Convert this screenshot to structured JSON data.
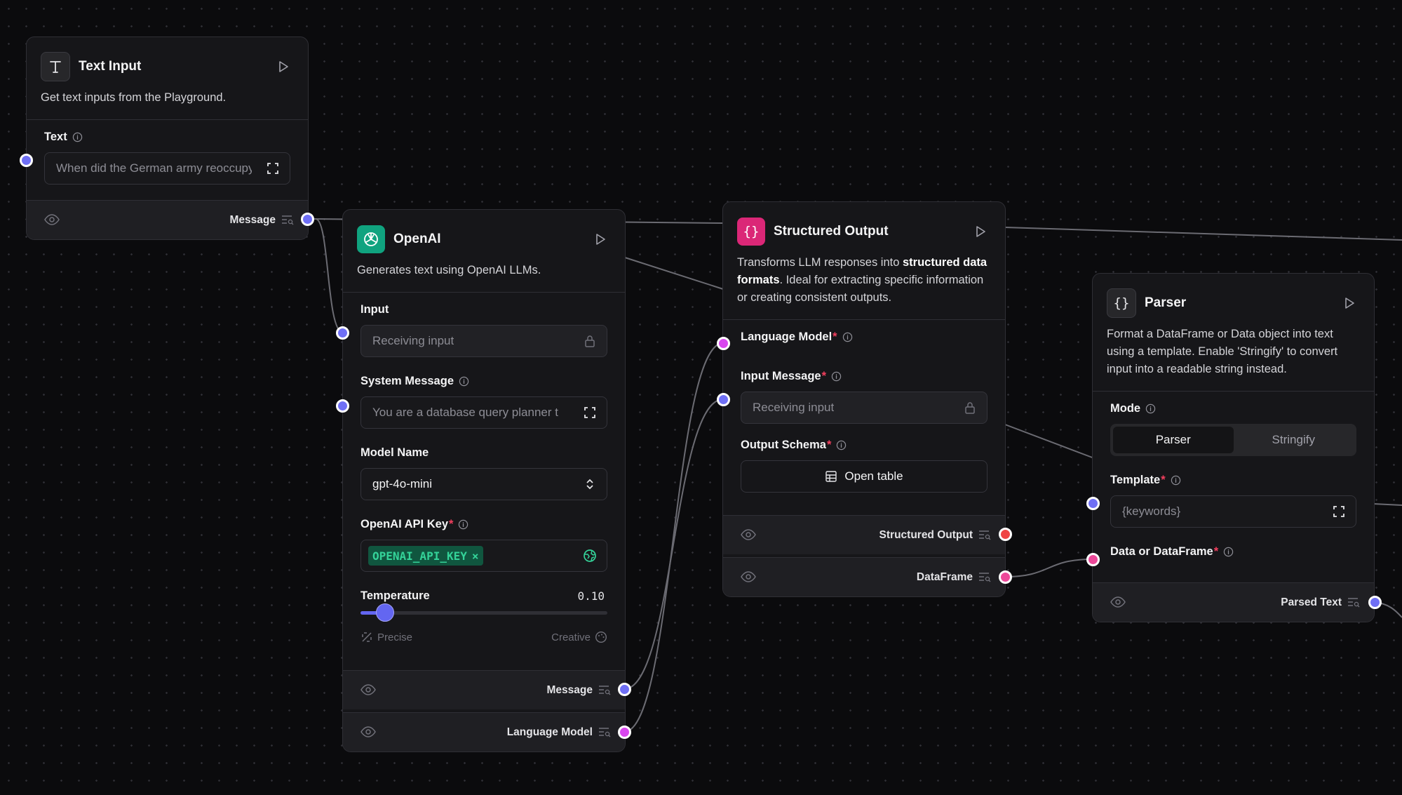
{
  "colors": {
    "canvas": "#0b0b0d",
    "node_bg": "#161619",
    "handle_blue": "#6f6ff5",
    "handle_magenta": "#d946ef",
    "handle_pink": "#ec4899",
    "handle_red": "#ef4444",
    "badge_green": "#34d399"
  },
  "text_input_node": {
    "title": "Text Input",
    "icon": "text-type-icon",
    "description": "Get text inputs from the Playground.",
    "text_label": "Text",
    "text_value": "When did the German army reoccupy",
    "output_label": "Message"
  },
  "openai_node": {
    "title": "OpenAI",
    "icon": "openai-logo-icon",
    "description": "Generates text using OpenAI LLMs.",
    "input_label": "Input",
    "input_placeholder": "Receiving input",
    "system_message_label": "System Message",
    "system_message_value": "You are a database query planner t",
    "model_name_label": "Model Name",
    "model_name_value": "gpt-4o-mini",
    "api_key_label": "OpenAI API Key",
    "api_key_value": "OPENAI_API_KEY",
    "temperature_label": "Temperature",
    "temperature_value": "0.10",
    "temperature_fraction": 0.1,
    "precise_label": "Precise",
    "creative_label": "Creative",
    "output_message_label": "Message",
    "output_model_label": "Language Model"
  },
  "structured_node": {
    "title": "Structured Output",
    "icon": "braces-icon",
    "desc_1": "Transforms LLM responses into ",
    "desc_bold": "structured data formats",
    "desc_2": ". Ideal for extracting specific information or creating consistent outputs.",
    "language_model_label": "Language Model",
    "input_message_label": "Input Message",
    "input_message_placeholder": "Receiving input",
    "output_schema_label": "Output Schema",
    "open_table_label": "Open table",
    "output_structured_label": "Structured Output",
    "output_dataframe_label": "DataFrame"
  },
  "parser_node": {
    "title": "Parser",
    "icon": "braces-icon",
    "description": "Format a DataFrame or Data object into text using a template. Enable 'Stringify' to convert input into a readable string instead.",
    "mode_label": "Mode",
    "mode_parser": "Parser",
    "mode_stringify": "Stringify",
    "template_label": "Template",
    "template_value": "{keywords}",
    "data_label": "Data or DataFrame",
    "output_label": "Parsed Text"
  }
}
